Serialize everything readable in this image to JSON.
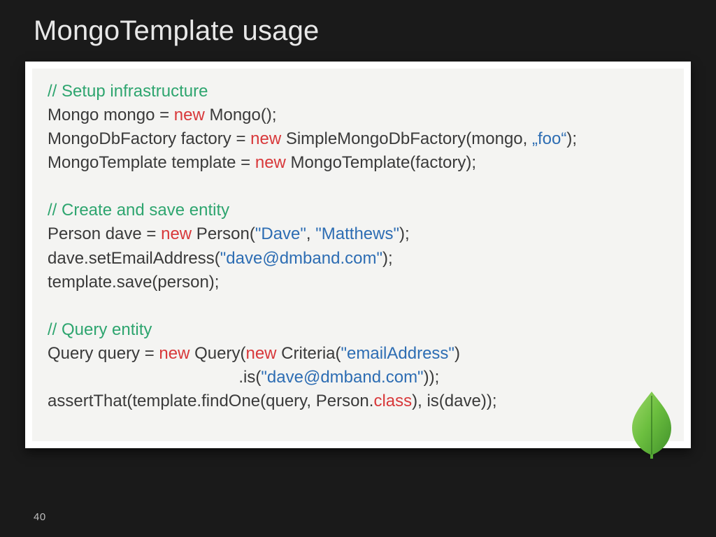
{
  "title": "MongoTemplate usage",
  "pageNumber": "40",
  "logo": {
    "name": "mongodb-leaf"
  },
  "code": {
    "block1": {
      "comment": "// Setup infrastructure",
      "l1a": "Mongo mongo = ",
      "l1kw": "new",
      "l1b": " Mongo();",
      "l2a": "MongoDbFactory factory = ",
      "l2kw": "new",
      "l2b": " SimpleMongoDbFactory(mongo, ",
      "l2str": "„foo“",
      "l2c": ");",
      "l3a": "MongoTemplate template = ",
      "l3kw": "new",
      "l3b": " MongoTemplate(factory);"
    },
    "block2": {
      "comment": "// Create and save entity",
      "l1a": "Person dave = ",
      "l1kw": "new",
      "l1b": " Person(",
      "l1s1": "\"Dave\"",
      "l1c": ", ",
      "l1s2": "\"Matthews\"",
      "l1d": ");",
      "l2a": "dave.setEmailAddress(",
      "l2s": "\"dave@dmband.com\"",
      "l2b": ");",
      "l3": "template.save(person);"
    },
    "block3": {
      "comment": "// Query entity",
      "l1a": "Query query = ",
      "l1kw1": "new",
      "l1b": " Query(",
      "l1kw2": "new",
      "l1c": " Criteria(",
      "l1s": "\"emailAddress\"",
      "l1d": ")",
      "l2a": "                                         .is(",
      "l2s": "\"dave@dmband.com\"",
      "l2b": "));",
      "l3a": "assertThat(template.findOne(query, Person.",
      "l3kw": "class",
      "l3b": "), is(dave));"
    }
  }
}
